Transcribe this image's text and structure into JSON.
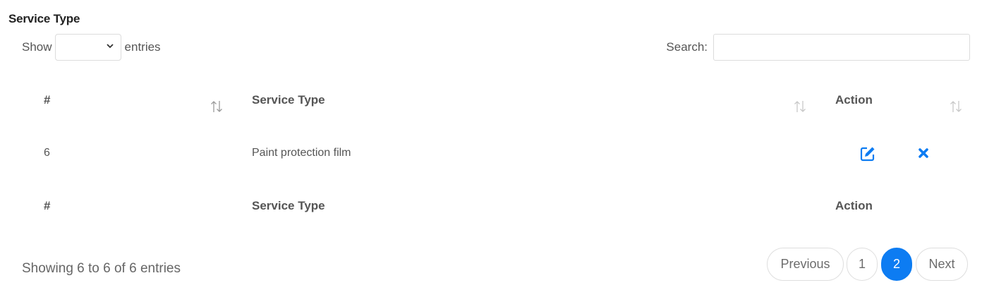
{
  "title": "Service Type",
  "length": {
    "prefix": "Show",
    "suffix": "entries",
    "selected": ""
  },
  "search": {
    "label": "Search:",
    "value": ""
  },
  "table": {
    "headers": [
      "#",
      "Service Type",
      "Action"
    ],
    "rows": [
      {
        "num": "6",
        "service_type": "Paint protection film",
        "actions": [
          "edit-icon",
          "delete-icon"
        ]
      }
    ],
    "footer": [
      "#",
      "Service Type",
      "Action"
    ]
  },
  "info": "Showing 6 to 6 of 6 entries",
  "pagination": {
    "previous": "Previous",
    "pages": [
      "1",
      "2"
    ],
    "current": "2",
    "next": "Next"
  },
  "colors": {
    "accent": "#0d7cf2",
    "text": "#555555"
  }
}
